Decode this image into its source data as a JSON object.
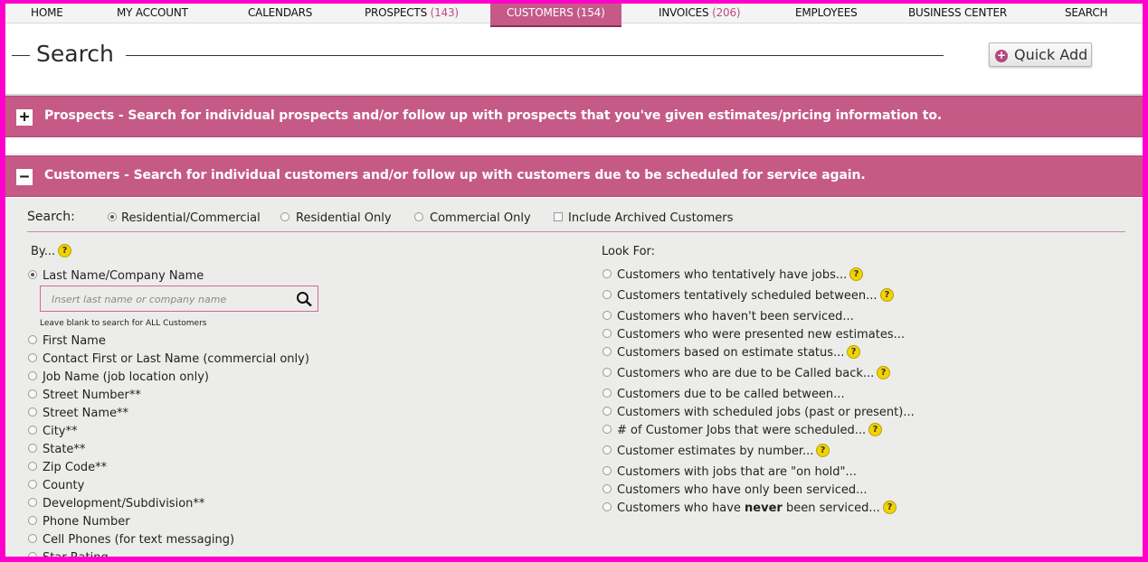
{
  "nav": {
    "items": [
      {
        "label": "HOME",
        "count": ""
      },
      {
        "label": "MY ACCOUNT",
        "count": ""
      },
      {
        "label": "CALENDARS",
        "count": ""
      },
      {
        "label": "PROSPECTS",
        "count": "(143)"
      },
      {
        "label": "CUSTOMERS",
        "count": "(154)"
      },
      {
        "label": "INVOICES",
        "count": "(206)"
      },
      {
        "label": "EMPLOYEES",
        "count": ""
      },
      {
        "label": "BUSINESS CENTER",
        "count": ""
      },
      {
        "label": "SEARCH",
        "count": ""
      }
    ],
    "active": "CUSTOMERS"
  },
  "header": {
    "title": "Search",
    "quick_add": "Quick Add"
  },
  "sections": {
    "prospects": {
      "toggle": "+",
      "label": "Prospects - Search for individual prospects and/or follow up with prospects that you've given estimates/pricing information to."
    },
    "customers": {
      "toggle": "−",
      "label": "Customers - Search for individual customers and/or follow up with customers due to be scheduled for service again."
    }
  },
  "search": {
    "label": "Search:",
    "options": [
      "Residential/Commercial",
      "Residential Only",
      "Commercial Only"
    ],
    "selected": "Residential/Commercial",
    "archived_label": "Include Archived Customers",
    "archived_checked": false
  },
  "by": {
    "heading": "By...",
    "selected": "Last Name/Company Name",
    "first": "Last Name/Company Name",
    "input_placeholder": "Insert last name or company name",
    "hint": "Leave blank to search for ALL Customers",
    "items": [
      "First Name",
      "Contact First or Last Name (commercial only)",
      "Job Name (job location only)",
      "Street Number**",
      "Street Name**",
      "City**",
      "State**",
      "Zip Code**",
      "County",
      "Development/Subdivision**",
      "Phone Number",
      "Cell Phones (for text messaging)",
      "Star Rating"
    ]
  },
  "look_for": {
    "heading": "Look For:",
    "items": [
      {
        "label": "Customers who tentatively have jobs...",
        "help": true
      },
      {
        "label": "Customers tentatively scheduled between...",
        "help": true
      },
      {
        "label": "Customers who haven't been serviced...",
        "help": false
      },
      {
        "label": "Customers who were presented new estimates...",
        "help": false
      },
      {
        "label": "Customers based on estimate status...",
        "help": true
      },
      {
        "label": "Customers who are due to be Called back...",
        "help": true
      },
      {
        "label": "Customers due to be called between...",
        "help": false
      },
      {
        "label": "Customers with scheduled jobs (past or present)...",
        "help": false
      },
      {
        "label": "# of Customer Jobs that were scheduled...",
        "help": true
      },
      {
        "label": "Customer estimates by number...",
        "help": true
      },
      {
        "label": "Customers with jobs that are \"on hold\"...",
        "help": false
      },
      {
        "label": "Customers who have only been serviced...",
        "help": false
      },
      {
        "label_pre": "Customers who have ",
        "label_bold": "never",
        "label_post": " been serviced...",
        "help": true
      }
    ]
  },
  "help_glyph": "?",
  "colors": {
    "accent": "#c55a87",
    "frame": "#ff00cc",
    "panel": "#ececea",
    "help": "#f1d400"
  }
}
